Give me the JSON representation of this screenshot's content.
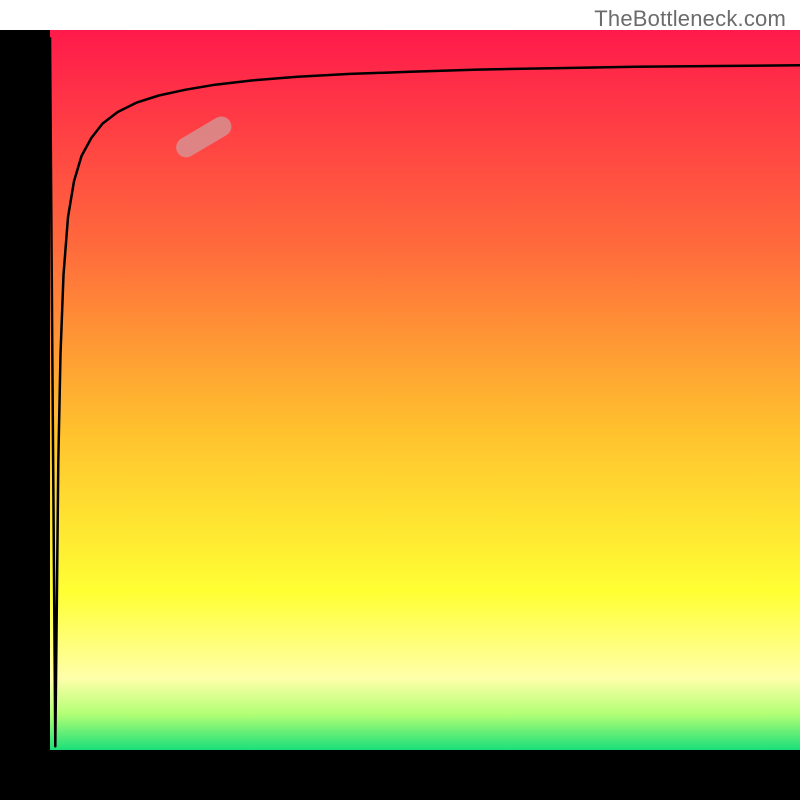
{
  "watermark": "TheBottleneck.com",
  "chart_data": {
    "type": "line",
    "title": "",
    "xlabel": "",
    "ylabel": "",
    "xlim": [
      0,
      100
    ],
    "ylim": [
      0,
      100
    ],
    "axes": {
      "left_margin_pct": 6.25,
      "bottom_margin_pct": 6.25,
      "top_margin_pct": 3.75,
      "right_margin_pct": 0.0
    },
    "background_gradient": {
      "stops": [
        {
          "at": 0.0,
          "color": "#ff1a4b"
        },
        {
          "at": 0.3,
          "color": "#ff6a3c"
        },
        {
          "at": 0.55,
          "color": "#ffbf2e"
        },
        {
          "at": 0.78,
          "color": "#ffff33"
        },
        {
          "at": 0.9,
          "color": "#ffffaa"
        },
        {
          "at": 0.95,
          "color": "#b3ff75"
        },
        {
          "at": 1.0,
          "color": "#1adf7a"
        }
      ]
    },
    "series": [
      {
        "name": "curve",
        "stroke": "#000000",
        "x": [
          0.0,
          0.35,
          0.7,
          0.9,
          1.1,
          1.4,
          1.8,
          2.4,
          3.2,
          4.2,
          5.5,
          7.0,
          9.0,
          11.5,
          14.5,
          18.0,
          22.0,
          27.0,
          33.0,
          40.0,
          48.0,
          57.0,
          67.0,
          78.0,
          89.0,
          100.0
        ],
        "y": [
          99.0,
          50.0,
          0.5,
          20.0,
          40.0,
          55.0,
          66.0,
          74.0,
          79.0,
          82.5,
          85.0,
          87.0,
          88.6,
          89.9,
          90.9,
          91.7,
          92.4,
          93.0,
          93.5,
          93.9,
          94.2,
          94.5,
          94.7,
          94.9,
          95.0,
          95.1
        ]
      }
    ],
    "highlight_segment": {
      "x_range": [
        17.0,
        24.0
      ],
      "y_range": [
        83.0,
        87.3
      ],
      "color": "#d88f8f",
      "opacity": 0.85
    }
  }
}
